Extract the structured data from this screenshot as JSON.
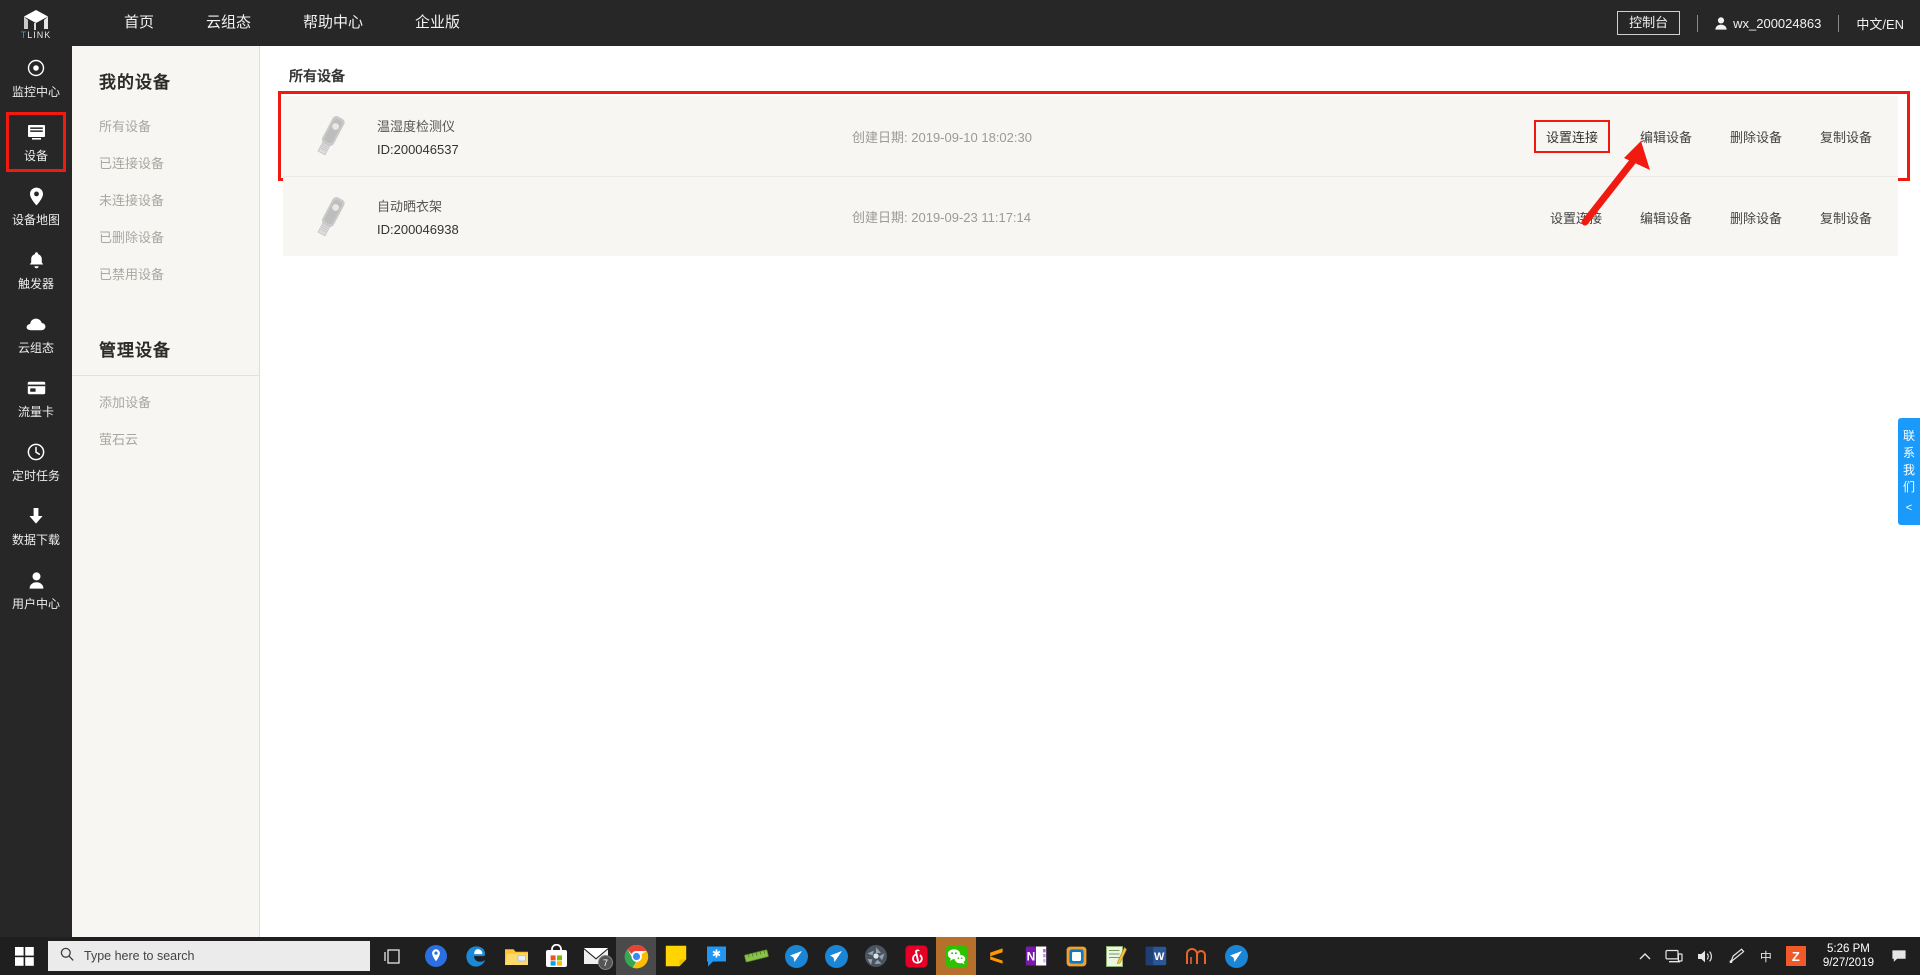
{
  "brand": {
    "name_primary": "T",
    "name_secondary": "LINK"
  },
  "topnav": {
    "items": [
      {
        "label": "首页",
        "name": "nav-home"
      },
      {
        "label": "云组态",
        "name": "nav-cloud-scada"
      },
      {
        "label": "帮助中心",
        "name": "nav-help-center"
      },
      {
        "label": "企业版",
        "name": "nav-enterprise"
      }
    ],
    "console_label": "控制台",
    "username": "wx_200024863",
    "language_label": "中文/EN"
  },
  "rail": {
    "items": [
      {
        "label": "监控中心",
        "icon": "target-icon",
        "active": false
      },
      {
        "label": "设备",
        "icon": "device-icon",
        "active": true
      },
      {
        "label": "设备地图",
        "icon": "map-pin-icon",
        "active": false
      },
      {
        "label": "触发器",
        "icon": "bell-icon",
        "active": false
      },
      {
        "label": "云组态",
        "icon": "cloud-icon",
        "active": false
      },
      {
        "label": "流量卡",
        "icon": "sim-card-icon",
        "active": false
      },
      {
        "label": "定时任务",
        "icon": "clock-icon",
        "active": false
      },
      {
        "label": "数据下载",
        "icon": "download-icon",
        "active": false
      },
      {
        "label": "用户中心",
        "icon": "user-icon",
        "active": false
      }
    ]
  },
  "subnav": {
    "group1_title": "我的设备",
    "group1_items": [
      {
        "label": "所有设备"
      },
      {
        "label": "已连接设备"
      },
      {
        "label": "未连接设备"
      },
      {
        "label": "已删除设备"
      },
      {
        "label": "已禁用设备"
      }
    ],
    "group2_title": "管理设备",
    "group2_items": [
      {
        "label": "添加设备"
      },
      {
        "label": "萤石云"
      }
    ]
  },
  "main": {
    "title": "所有设备",
    "date_label": "创建日期:",
    "actions": {
      "configure": "设置连接",
      "edit": "编辑设备",
      "delete": "删除设备",
      "copy": "复制设备"
    },
    "devices": [
      {
        "name": "温湿度检测仪",
        "id": "ID:200046537",
        "created": "2019-09-10 18:02:30",
        "highlighted": true
      },
      {
        "name": "自动晒衣架",
        "id": "ID:200046938",
        "created": "2019-09-23 11:17:14",
        "highlighted": false
      }
    ]
  },
  "contact_tab": {
    "text": "联系我们",
    "arrow": "<"
  },
  "taskbar": {
    "search_placeholder": "Type here to search",
    "apps": [
      {
        "name": "taskbar-maps-icon"
      },
      {
        "name": "taskbar-edge-icon"
      },
      {
        "name": "taskbar-file-explorer-icon"
      },
      {
        "name": "taskbar-microsoft-store-icon"
      },
      {
        "name": "taskbar-mail-icon",
        "badge": "7"
      },
      {
        "name": "taskbar-chrome-icon",
        "running": "chrome"
      },
      {
        "name": "taskbar-sticky-notes-icon"
      },
      {
        "name": "taskbar-messenger-icon"
      },
      {
        "name": "taskbar-ruler-icon"
      },
      {
        "name": "taskbar-app-blue1-icon"
      },
      {
        "name": "taskbar-app-blue2-icon"
      },
      {
        "name": "taskbar-camera-icon"
      },
      {
        "name": "taskbar-netease-music-icon"
      },
      {
        "name": "taskbar-wechat-icon",
        "running": "wechat"
      },
      {
        "name": "taskbar-sublime-icon"
      },
      {
        "name": "taskbar-onenote-icon"
      },
      {
        "name": "taskbar-outlook-icon"
      },
      {
        "name": "taskbar-notepad-icon"
      },
      {
        "name": "taskbar-word-icon"
      },
      {
        "name": "taskbar-navicat-icon"
      },
      {
        "name": "taskbar-app-blue3-icon"
      }
    ],
    "tray": {
      "ime_label": "中",
      "badge_label": "Z",
      "time": "5:26 PM",
      "date": "9/27/2019"
    }
  },
  "colors": {
    "nav_bg": "#272727",
    "panel_bg": "#f7f6f2",
    "accent_red": "#f01a10",
    "accent_blue": "#1a9bfc"
  }
}
